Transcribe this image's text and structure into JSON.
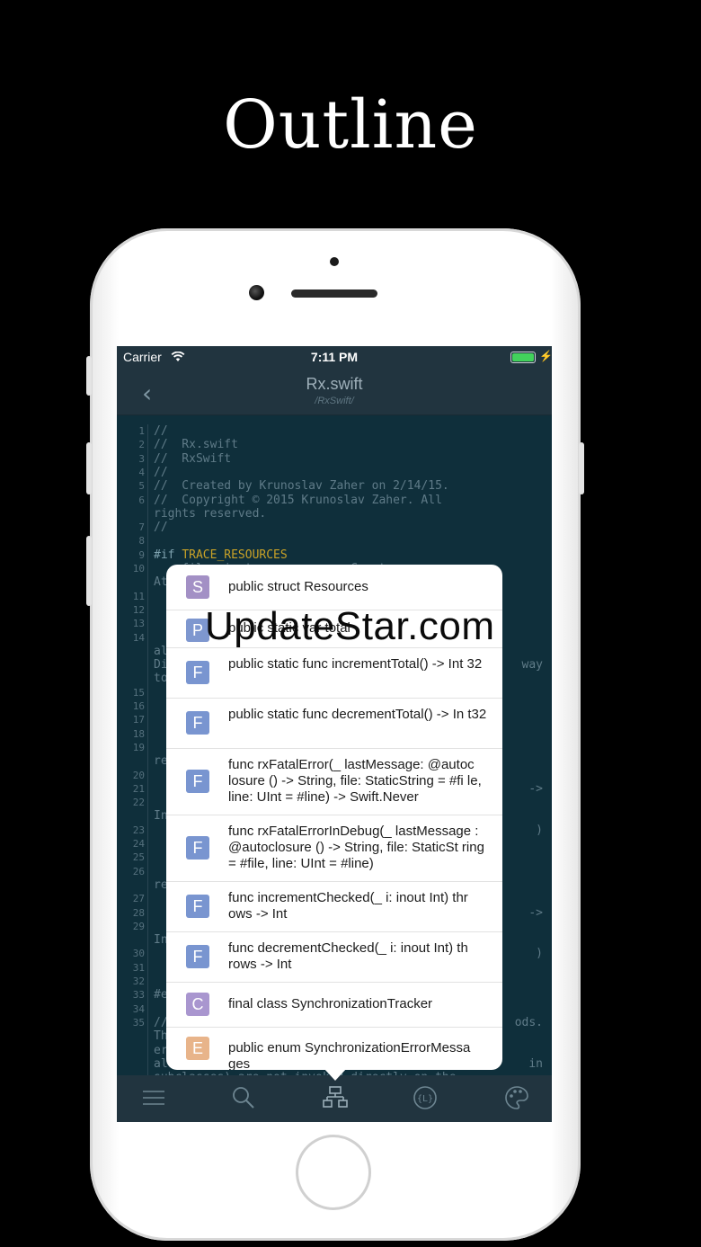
{
  "headline": "Outline",
  "status": {
    "carrier": "Carrier",
    "time": "7:11 PM"
  },
  "nav": {
    "title": "Rx.swift",
    "subtitle": "/RxSwift/"
  },
  "code_lines": [
    {
      "n": "1",
      "t": "//"
    },
    {
      "n": "2",
      "t": "//  Rx.swift"
    },
    {
      "n": "3",
      "t": "//  RxSwift"
    },
    {
      "n": "4",
      "t": "//"
    },
    {
      "n": "5",
      "t": "//  Created by Krunoslav Zaher on 2/14/15."
    },
    {
      "n": "6",
      "t": "//  Copyright © 2015 Krunoslav Zaher. All"
    },
    {
      "n": "",
      "t": "rights reserved."
    },
    {
      "n": "7",
      "t": "//"
    },
    {
      "n": "8",
      "t": ""
    },
    {
      "n": "9",
      "t": "#if ",
      "macro": "TRACE_RESOURCES"
    },
    {
      "n": "10",
      "t": "    fileprivate var resourceCount ="
    },
    {
      "n": "",
      "t": "At"
    },
    {
      "n": "11",
      "t": ""
    },
    {
      "n": "12",
      "t": ""
    },
    {
      "n": "13",
      "t": ""
    },
    {
      "n": "14",
      "t": ""
    },
    {
      "n": "",
      "t": "al"
    },
    {
      "n": "",
      "t": "Di"
    },
    {
      "n": "",
      "t": "to"
    },
    {
      "n": "15",
      "t": ""
    },
    {
      "n": "16",
      "t": ""
    },
    {
      "n": "17",
      "t": ""
    },
    {
      "n": "18",
      "t": ""
    },
    {
      "n": "19",
      "t": ""
    },
    {
      "n": "",
      "t": "re"
    },
    {
      "n": "20",
      "t": ""
    },
    {
      "n": "21",
      "t": ""
    },
    {
      "n": "22",
      "t": ""
    },
    {
      "n": "",
      "t": "In"
    },
    {
      "n": "23",
      "t": ""
    },
    {
      "n": "24",
      "t": ""
    },
    {
      "n": "25",
      "t": ""
    },
    {
      "n": "26",
      "t": ""
    },
    {
      "n": "",
      "t": "re"
    },
    {
      "n": "27",
      "t": ""
    },
    {
      "n": "28",
      "t": ""
    },
    {
      "n": "29",
      "t": ""
    },
    {
      "n": "",
      "t": "In"
    },
    {
      "n": "30",
      "t": ""
    },
    {
      "n": "31",
      "t": ""
    },
    {
      "n": "32",
      "t": ""
    },
    {
      "n": "33",
      "t": "#e"
    },
    {
      "n": "34",
      "t": ""
    },
    {
      "n": "35",
      "t": "//"
    },
    {
      "n": "",
      "t": "Th"
    },
    {
      "n": "",
      "t": "er"
    },
    {
      "n": "",
      "t": "al"
    },
    {
      "n": "",
      "t": "subclasses) are not invoked directly on the"
    }
  ],
  "code_right": [
    {
      "line": 17,
      "t": "way"
    },
    {
      "line": 26,
      "t": "->"
    },
    {
      "line": 29,
      "t": ")"
    },
    {
      "line": 35,
      "t": "->"
    },
    {
      "line": 38,
      "t": ")"
    },
    {
      "line": 43,
      "t": "ods."
    },
    {
      "line": 46,
      "t": "in"
    }
  ],
  "outline_items": [
    {
      "badge": "S",
      "text": "public struct Resources"
    },
    {
      "badge": "P",
      "text": "public static var total"
    },
    {
      "badge": "F",
      "text": "public static func incrementTotal() -> Int 32"
    },
    {
      "badge": "F",
      "text": "public static func decrementTotal() -> In t32"
    },
    {
      "badge": "F",
      "text": "func rxFatalError(_ lastMessage: @autoc losure () -> String, file: StaticString = #fi le, line: UInt = #line) -> Swift.Never"
    },
    {
      "badge": "F",
      "text": "func rxFatalErrorInDebug(_ lastMessage : @autoclosure () -> String, file: StaticSt ring = #file, line: UInt = #line)"
    },
    {
      "badge": "F",
      "text": "func incrementChecked(_ i: inout Int) thr ows -> Int"
    },
    {
      "badge": "F",
      "text": "func decrementChecked(_ i: inout Int) th rows -> Int"
    },
    {
      "badge": "C",
      "text": "final class SynchronizationTracker"
    },
    {
      "badge": "E",
      "text": "public enum SynchronizationErrorMessa ges"
    }
  ],
  "tabs": [
    {
      "name": "menu-icon"
    },
    {
      "name": "search-icon"
    },
    {
      "name": "outline-icon"
    },
    {
      "name": "symbols-icon"
    },
    {
      "name": "theme-palette-icon"
    }
  ],
  "watermark": "UpdateStar.com",
  "colors": {
    "background": "#000000",
    "editor": "#0f2f3b",
    "bars": "#21343f",
    "macro": "#c9a227"
  }
}
